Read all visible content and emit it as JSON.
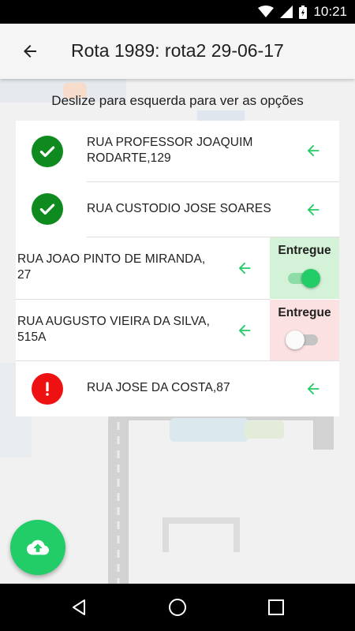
{
  "status_bar": {
    "time": "10:21"
  },
  "app_bar": {
    "title": "Rota 1989: rota2 29-06-17"
  },
  "hint": "Deslize para esquerda para ver as opções",
  "colors": {
    "accent": "#22cc66",
    "ok": "#0f8a1f",
    "error": "#ee1111",
    "arrow": "#22cc66"
  },
  "deliveries": [
    {
      "address": "RUA PROFESSOR JOAQUIM RODARTE,129",
      "line1": "RUA PROFESSOR JOAQUIM",
      "line2": "RODARTE,129",
      "status": "delivered",
      "icon": "check-circle-icon"
    },
    {
      "address": "RUA CUSTODIO JOSE SOARES",
      "line1": "RUA CUSTODIO JOSE SOARES",
      "status": "delivered",
      "icon": "check-circle-icon"
    },
    {
      "address": "RUA JOAO PINTO DE MIRANDA, 27",
      "line1": "RUA JOAO PINTO DE MIRANDA,",
      "line2": "27",
      "status": "swiped",
      "action_label": "Entregue",
      "toggle_on": true
    },
    {
      "address": "RUA AUGUSTO VIEIRA DA SILVA, 515A",
      "line1": "RUA AUGUSTO VIEIRA DA SILVA,",
      "line2": "515A",
      "status": "swiped",
      "action_label": "Entregue",
      "toggle_on": false
    },
    {
      "address": "RUA JOSE DA COSTA,87",
      "line1": "RUA JOSE DA COSTA,87",
      "status": "failed",
      "icon": "exclamation-circle-icon"
    }
  ],
  "fab": {
    "icon": "cloud-upload-icon"
  },
  "nav": {
    "icons": [
      "back-triangle-icon",
      "home-circle-icon",
      "recents-square-icon"
    ]
  }
}
